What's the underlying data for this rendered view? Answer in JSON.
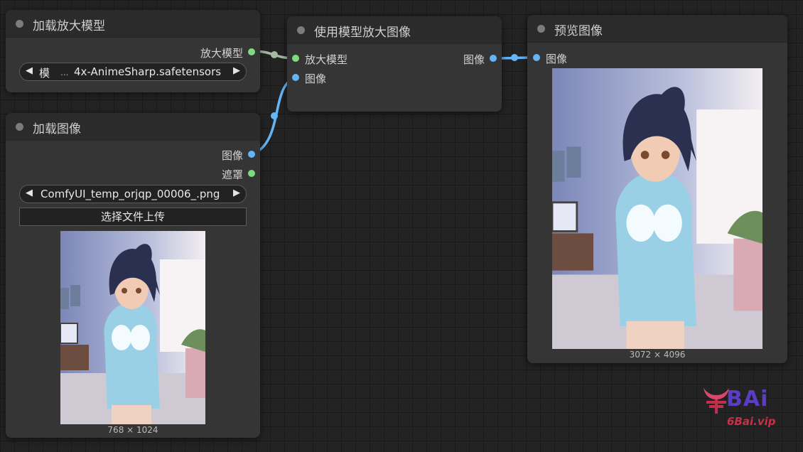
{
  "nodes": {
    "load_upscale_model": {
      "title": "加载放大模型",
      "output_label": "放大模型",
      "model_widget_label": "模",
      "model_widget_ellipsis": "...",
      "model_widget_value": "4x-AnimeSharp.safetensors"
    },
    "load_image": {
      "title": "加载图像",
      "output_image_label": "图像",
      "output_mask_label": "遮罩",
      "image_widget_value": "ComfyUI_temp_orjqp_00006_.png",
      "upload_button_label": "选择文件上传",
      "image_dims": "768 × 1024"
    },
    "upscale_with_model": {
      "title": "使用模型放大图像",
      "input_model_label": "放大模型",
      "input_image_label": "图像",
      "output_image_label": "图像"
    },
    "preview_image": {
      "title": "预览图像",
      "input_image_label": "图像",
      "image_dims": "3072 × 4096"
    }
  },
  "watermark": {
    "logo_text": "BAi",
    "site": "6Bai.vip"
  },
  "colors": {
    "canvas": "#232323",
    "node_body": "#353535",
    "node_header": "#2b2b2b",
    "model_link": "#a3b9a3",
    "image_link": "#64b5f6",
    "slot_green": "#7edb7e",
    "slot_blue": "#64b5f6"
  },
  "icons": {
    "left_arrow": "◀",
    "right_arrow": "▶"
  }
}
